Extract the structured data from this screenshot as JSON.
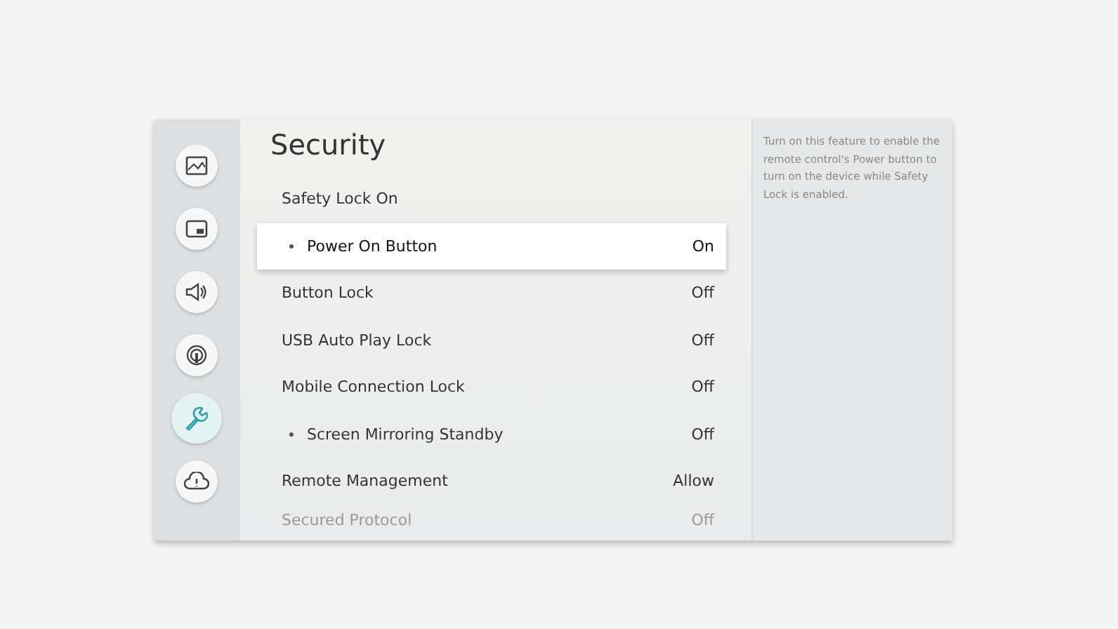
{
  "sidebar": {
    "items": [
      {
        "kind": "picture",
        "selected": false
      },
      {
        "kind": "pip",
        "selected": false
      },
      {
        "kind": "sound",
        "selected": false
      },
      {
        "kind": "broadcast",
        "selected": false
      },
      {
        "kind": "wrench",
        "selected": true
      },
      {
        "kind": "support",
        "selected": false
      }
    ]
  },
  "title": "Security",
  "rows": [
    {
      "label": "Safety Lock On",
      "value": "",
      "sub": false,
      "selected": false,
      "faded": false
    },
    {
      "label": "Power On Button",
      "value": "On",
      "sub": true,
      "selected": true,
      "faded": false
    },
    {
      "label": "Button Lock",
      "value": "Off",
      "sub": false,
      "selected": false,
      "faded": false
    },
    {
      "label": "USB Auto Play Lock",
      "value": "Off",
      "sub": false,
      "selected": false,
      "faded": false
    },
    {
      "label": "Mobile Connection Lock",
      "value": "Off",
      "sub": false,
      "selected": false,
      "faded": false
    },
    {
      "label": "Screen Mirroring Standby",
      "value": "Off",
      "sub": true,
      "selected": false,
      "faded": false
    },
    {
      "label": "Remote Management",
      "value": "Allow",
      "sub": false,
      "selected": false,
      "faded": false
    },
    {
      "label": "Secured Protocol",
      "value": "Off",
      "sub": false,
      "selected": false,
      "faded": true
    }
  ],
  "description": "Turn on this feature to enable the remote control's Power button to turn on the device while Safety Lock is enabled."
}
